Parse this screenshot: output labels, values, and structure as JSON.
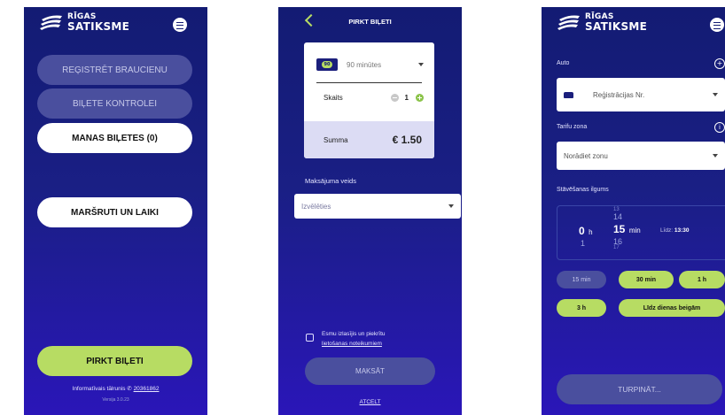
{
  "brand": {
    "line1": "RĪGAS",
    "line2": "SATIKSME"
  },
  "home": {
    "buttons": [
      {
        "label": "REĢISTRĒT BRAUCIENU"
      },
      {
        "label": "BIĻETE KONTROLEI"
      },
      {
        "label": "MANAS BIĻETES (0)"
      },
      {
        "label": "MARŠRUTI UN LAIKI"
      },
      {
        "label": "PIRKT BIĻETI"
      }
    ],
    "info_label": "Informatīvais tālrunis",
    "info_phone": "20361862",
    "version": "Versija 3.0.23"
  },
  "buy": {
    "title": "PIRKT BIĻETI",
    "ticket_badge": "90",
    "ticket_type": "90 minūtes",
    "count_label": "Skaits",
    "count_value": "1",
    "sum_label": "Summa",
    "sum_value": "€ 1.50",
    "payment_label": "Maksājuma veids",
    "payment_placeholder": "Izvēlēties",
    "terms_line1": "Esmu izlasījis un piekrītu",
    "terms_link": "lietošanas noteikumiem",
    "pay_button": "MAKSĀT",
    "cancel": "ATCELT"
  },
  "parking": {
    "auto_label": "Auto",
    "plate_placeholder": "Reģistrācijas Nr.",
    "zone_label": "Tarifu zona",
    "zone_placeholder": "Norādiet zonu",
    "duration_label": "Stāvēšanas ilgums",
    "hours_value": "0",
    "hours_unit": "h",
    "hour_next": "1",
    "min_prev2": "13",
    "min_prev": "14",
    "min_value": "15",
    "min_unit": "min",
    "min_next": "16",
    "min_next2": "17",
    "until_label": "Līdz:",
    "until_value": "13:30",
    "chips": [
      "15 min",
      "30 min",
      "1 h",
      "3 h",
      "Līdz dienas beigām"
    ],
    "continue_button": "TURPINĀT..."
  },
  "colors": {
    "bg_top": "#131b73",
    "bg_bottom": "#2a16b8",
    "accent": "#b7dc63",
    "muted_button": "#4a4f9e"
  }
}
